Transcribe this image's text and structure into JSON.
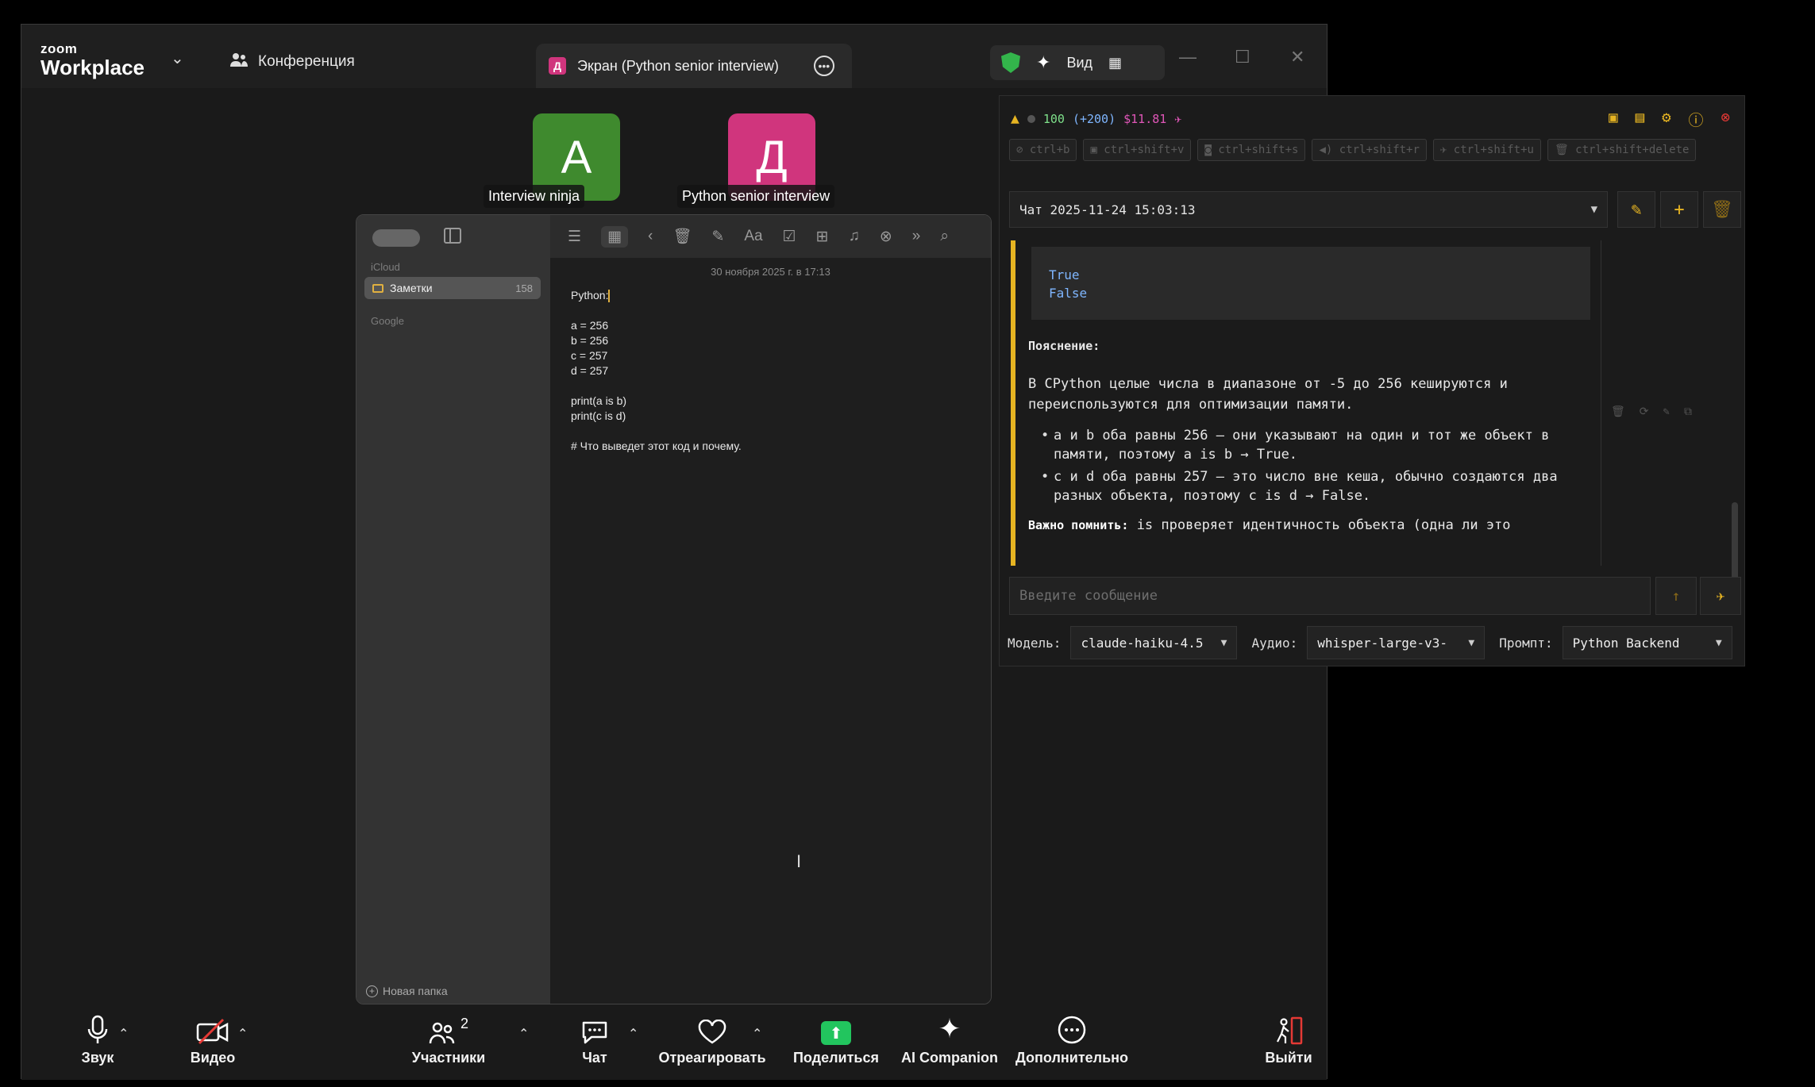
{
  "zoom": {
    "brand_small": "zoom",
    "brand": "Workplace",
    "conference_label": "Конференция",
    "screen_tab_avatar": "Д",
    "screen_tab_title": "Экран (Python senior interview)",
    "view_label": "Вид",
    "participants": [
      {
        "initial": "A",
        "name": "Interview ninja",
        "color": "#3f8a2e"
      },
      {
        "initial": "Д",
        "name": "Python senior interview",
        "color": "#d0357d"
      }
    ],
    "toolbar": {
      "audio": "Звук",
      "video": "Видео",
      "participants": "Участники",
      "participants_count": "2",
      "chat": "Чат",
      "react": "Отреагировать",
      "share": "Поделиться",
      "ai": "AI Companion",
      "more": "Дополнительно",
      "leave": "Выйти"
    }
  },
  "notes": {
    "sidebar": {
      "section_icloud": "iCloud",
      "folder_name": "Заметки",
      "folder_count": "158",
      "section_google": "Google",
      "new_folder": "Новая папка"
    },
    "date": "30 ноября 2025 г. в 17:13",
    "lines": [
      "Python:",
      "",
      "a = 256",
      "b = 256",
      "c = 257",
      "d = 257",
      "",
      "print(a is b)",
      "print(c is d)",
      "",
      "# Что выведет этот код и почему."
    ]
  },
  "ai_panel": {
    "status": {
      "count": "100",
      "delta": "(+200)",
      "cost": "$11.81"
    },
    "shortcuts": [
      "ctrl+b",
      "ctrl+shift+v",
      "ctrl+shift+s",
      "ctrl+shift+r",
      "ctrl+shift+u",
      "ctrl+shift+delete"
    ],
    "chat_title": "Чат 2025-11-24 15:03:13",
    "code_output": [
      "True",
      "False"
    ],
    "explanation_heading": "Пояснение:",
    "p1": "В CPython целые числа в диапазоне от -5 до 256 кешируются и переиспользуются для оптимизации памяти.",
    "bullet1": "a и b оба равны 256 — они указывают на один и тот же объект в памяти, поэтому a is b → True.",
    "bullet2": "c и d оба равны 257 — это число вне кеша, обычно создаются два разных объекта, поэтому c is d → False.",
    "important_label": "Важно помнить:",
    "important_text": "is проверяет идентичность объекта (одна ли это",
    "input_placeholder": "Введите сообщение",
    "model_label": "Модель:",
    "model_value": "claude-haiku-4.5",
    "audio_label": "Аудио:",
    "audio_value": "whisper-large-v3-",
    "prompt_label": "Промпт:",
    "prompt_value": "Python Backend",
    "colors": {
      "accent": "#e6b422",
      "code": "#7fb6ff",
      "cost": "#e056b8",
      "count": "#7ee08a"
    }
  }
}
